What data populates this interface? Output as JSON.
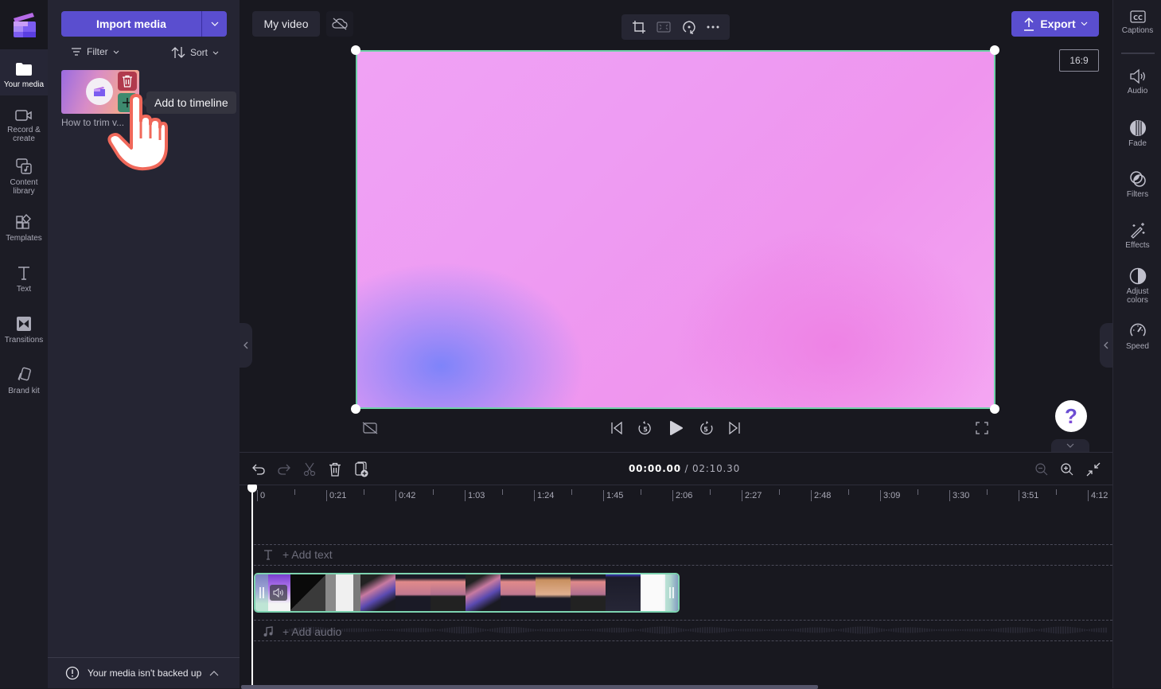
{
  "app": {
    "project_title": "My video",
    "accent_color": "#5a4ecf",
    "selection_color": "#6fd0a8"
  },
  "left_rail": {
    "items": [
      {
        "label": "Your media",
        "icon": "folder-icon",
        "active": true
      },
      {
        "label": "Record & create",
        "icon": "video-camera-icon",
        "active": false
      },
      {
        "label": "Content library",
        "icon": "content-library-icon",
        "active": false
      },
      {
        "label": "Templates",
        "icon": "templates-icon",
        "active": false
      },
      {
        "label": "Text",
        "icon": "text-icon",
        "active": false
      },
      {
        "label": "Transitions",
        "icon": "transitions-icon",
        "active": false
      },
      {
        "label": "Brand kit",
        "icon": "brand-kit-icon",
        "active": false
      }
    ]
  },
  "media_panel": {
    "import_label": "Import media",
    "filter_label": "Filter",
    "sort_label": "Sort",
    "items": [
      {
        "name": "How to trim v...",
        "delete_icon": "trash-icon",
        "add_icon": "plus-icon"
      }
    ],
    "tooltip": "Add to timeline",
    "backup_notice": "Your media isn't backed up"
  },
  "top_bar": {
    "toolbar_icons": [
      "crop-icon",
      "fit-icon",
      "rotate-icon",
      "more-icon"
    ],
    "export_label": "Export",
    "aspect_ratio": "16:9"
  },
  "right_rail": {
    "items": [
      {
        "label": "Captions",
        "icon": "captions-icon"
      },
      {
        "label": "Audio",
        "icon": "speaker-icon"
      },
      {
        "label": "Fade",
        "icon": "fade-icon"
      },
      {
        "label": "Filters",
        "icon": "filters-icon"
      },
      {
        "label": "Effects",
        "icon": "magic-wand-icon"
      },
      {
        "label": "Adjust colors",
        "icon": "adjust-colors-icon"
      },
      {
        "label": "Speed",
        "icon": "speedometer-icon"
      }
    ]
  },
  "playback": {
    "help_label": "?",
    "rewind_seconds": "5",
    "forward_seconds": "5"
  },
  "timeline": {
    "current_time": "00:00.00",
    "separator": " / ",
    "total_time": "02:10.30",
    "ruler_labels": [
      "0",
      "0:21",
      "0:42",
      "1:03",
      "1:24",
      "1:45",
      "2:06",
      "2:27",
      "2:48",
      "3:09",
      "3:30",
      "3:51",
      "4:12"
    ],
    "add_text_label": "+ Add text",
    "add_audio_label": "+ Add audio"
  }
}
